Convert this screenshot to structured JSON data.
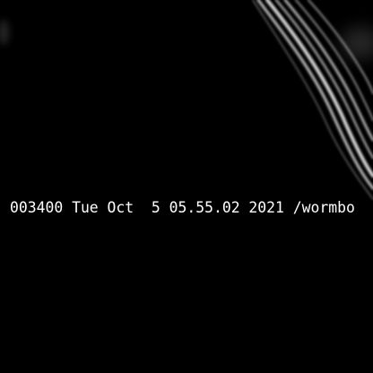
{
  "render": {
    "background_color": "#000000",
    "arc_color": "#d8d8d8",
    "glow_color": "#5a5a5a"
  },
  "status_line": {
    "text": "003400 Tue Oct  5 05.55.02 2021 /wormbo"
  }
}
